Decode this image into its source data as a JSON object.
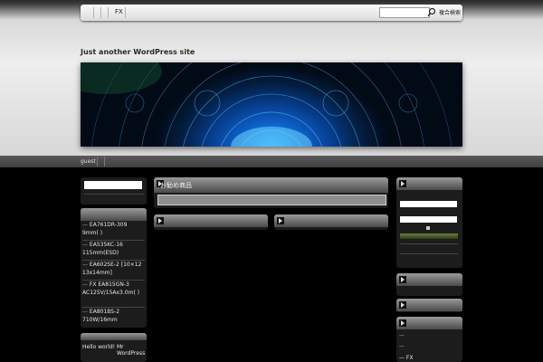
{
  "topbar": {
    "menu_item": "FX",
    "search_placeholder": "",
    "search_button": "複合検索"
  },
  "site": {
    "tagline": "Just another WordPress site"
  },
  "navbar": {
    "user_label": "guest"
  },
  "left_sidebar": {
    "products": [
      "EA761DR-309 9mm( )",
      "EA535KC-16 115mm(ESD)",
      "EA602SE-2 [10×12 13x14mm]",
      "FX EA815GN-3 AC125V/15Ax3.0m( )",
      "EA801BS-2 710W/16mm"
    ],
    "recent_posts": [
      "Hello world!",
      "Mr WordPress"
    ]
  },
  "main": {
    "section_title": "お勧め商品"
  },
  "right_sidebar": {
    "category_item": "FX"
  },
  "colors": {
    "accent_blue": "#1ea6ff",
    "widget_bg": "#1c1c1c",
    "header_bg": "#e6e6e6"
  }
}
